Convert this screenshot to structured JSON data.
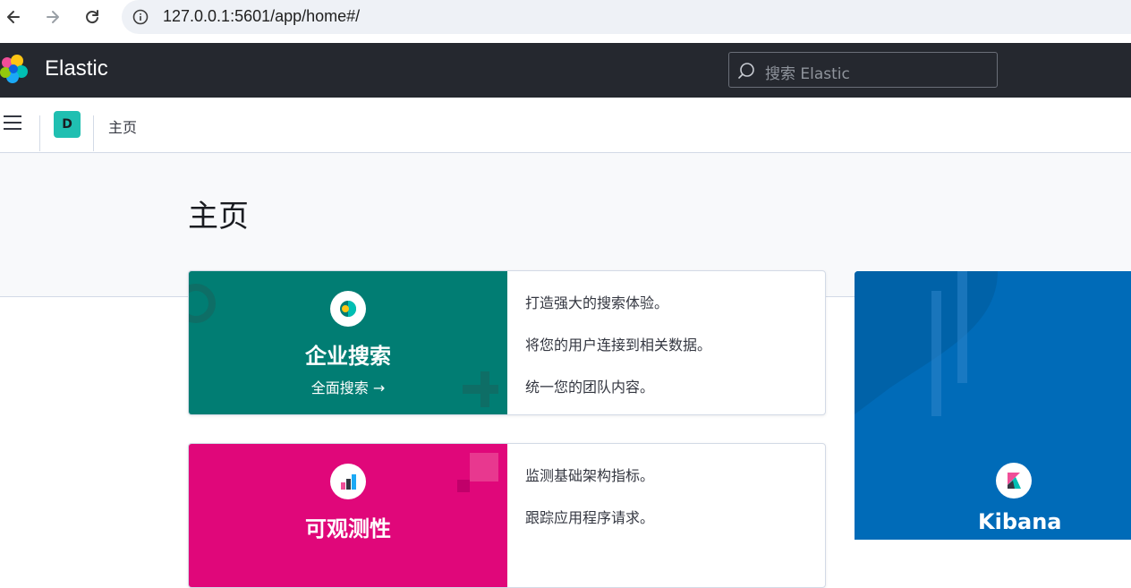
{
  "browser": {
    "url": "127.0.0.1:5601/app/home#/"
  },
  "header": {
    "brand": "Elastic",
    "search_placeholder": "搜索 Elastic"
  },
  "subbar": {
    "space_initial": "D",
    "breadcrumb": "主页"
  },
  "page": {
    "title": "主页"
  },
  "cards": {
    "enterprise_search": {
      "title": "企业搜索",
      "link": "全面搜索 →",
      "color": "#017d73",
      "lines": [
        "打造强大的搜索体验。",
        "将您的用户连接到相关数据。",
        "统一您的团队内容。"
      ]
    },
    "observability": {
      "title": "可观测性",
      "color": "#e0077a",
      "lines": [
        "监测基础架构指标。",
        "跟踪应用程序请求。"
      ]
    },
    "kibana": {
      "title": "Kibana",
      "color": "#006bb8"
    }
  }
}
